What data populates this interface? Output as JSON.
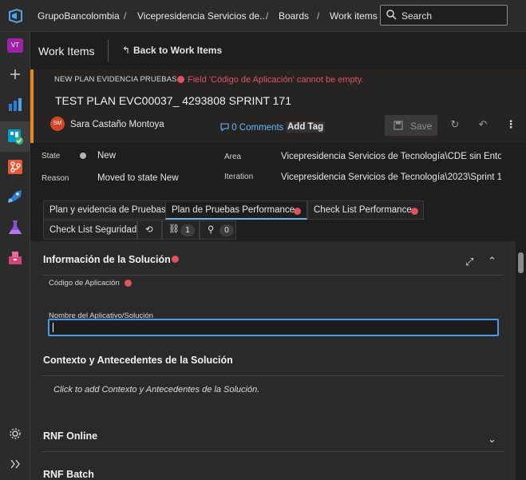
{
  "topbar": {
    "breadcrumbs": [
      "GrupoBancolombia",
      "Vicepresidencia Servicios de...",
      "Boards",
      "Work items"
    ],
    "search_placeholder": "Search"
  },
  "rail": {
    "avatar_initials": "VT",
    "items": [
      "add-icon",
      "overview-icon",
      "boards-icon",
      "repos-icon",
      "pipelines-icon",
      "test-plans-icon",
      "artifacts-icon",
      "settings-icon",
      "collapse-icon"
    ],
    "colors": {
      "boards": "#009ccc",
      "repos": "#e05a3a",
      "pipelines": "#2f7bd8",
      "test_plans": "#8e4fd6",
      "artifacts": "#d2447a"
    }
  },
  "header": {
    "title": "Work Items",
    "back_label": "Back to Work Items"
  },
  "work_item": {
    "type": "NEW PLAN EVIDENCIA PRUEBAS *",
    "error": "Field 'Código de Aplicación' cannot be empty.",
    "title": "TEST PLAN EVC00037_ 4293808 SPRINT 171",
    "assignee_initials": "SM",
    "assignee": "Sara Castaño Montoya",
    "comments": "0 Comments",
    "add_tag": "Add Tag",
    "save": "Save",
    "accent_color": "#e8891d",
    "error_color": "#e0525e"
  },
  "fields": {
    "state_label": "State",
    "state_value": "New",
    "reason_label": "Reason",
    "reason_value": "Moved to state New",
    "area_label": "Area",
    "area_value": "Vicepresidencia Servicios de Tecnología\\CDE sin Entor...",
    "iteration_label": "Iteration",
    "iteration_value": "Vicepresidencia Servicios de Tecnología\\2023\\Sprint 1..."
  },
  "tabs": {
    "t1": "Plan y evidencia de Pruebas",
    "t2": "Plan de Pruebas Performance",
    "t3": "Check List Performance",
    "t4": "Check List Seguridad",
    "links_count": "1",
    "attachments_count": "0"
  },
  "content": {
    "section1": "Información de la Solución",
    "codigo_label": "Código de Aplicación",
    "nombre_label": "Nombre del Aplicativo/Solución",
    "section2": "Contexto y Antecedentes de la Solución",
    "contexto_placeholder": "Click to add Contexto y Antecedentes de la Solución.",
    "section3": "RNF Online",
    "section4": "RNF Batch"
  }
}
